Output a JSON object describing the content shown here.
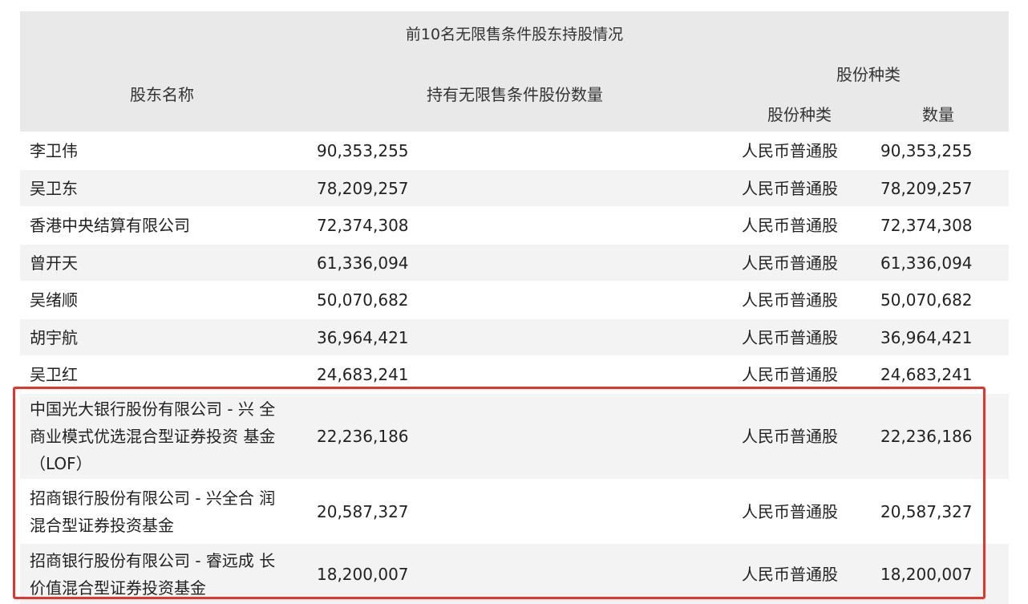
{
  "table": {
    "caption": "前10名无限售条件股东持股情况",
    "headers": {
      "shareholder_name": "股东名称",
      "unrestricted_qty": "持有无限售条件股份数量",
      "share_type_group": "股份种类",
      "share_type": "股份种类",
      "count": "数量"
    },
    "rows": [
      {
        "name_lines": [
          "李卫伟"
        ],
        "qty": "90,353,255",
        "type": "人民币普通股",
        "count": "90,353,255"
      },
      {
        "name_lines": [
          "吴卫东"
        ],
        "qty": "78,209,257",
        "type": "人民币普通股",
        "count": "78,209,257"
      },
      {
        "name_lines": [
          "香港中央结算有限公司"
        ],
        "qty": "72,374,308",
        "type": "人民币普通股",
        "count": "72,374,308"
      },
      {
        "name_lines": [
          "曾开天"
        ],
        "qty": "61,336,094",
        "type": "人民币普通股",
        "count": "61,336,094"
      },
      {
        "name_lines": [
          "吴绪顺"
        ],
        "qty": "50,070,682",
        "type": "人民币普通股",
        "count": "50,070,682"
      },
      {
        "name_lines": [
          "胡宇航"
        ],
        "qty": "36,964,421",
        "type": "人民币普通股",
        "count": "36,964,421"
      },
      {
        "name_lines": [
          "吴卫红"
        ],
        "qty": "24,683,241",
        "type": "人民币普通股",
        "count": "24,683,241"
      },
      {
        "name_lines": [
          "中国光大银行股份有限公司 - 兴 全",
          "商业模式优选混合型证券投资 基金",
          "（LOF）"
        ],
        "qty": "22,236,186",
        "type": "人民币普通股",
        "count": "22,236,186"
      },
      {
        "name_lines": [
          "招商银行股份有限公司 - 兴全合 润",
          "混合型证券投资基金"
        ],
        "qty": "20,587,327",
        "type": "人民币普通股",
        "count": "20,587,327"
      },
      {
        "name_lines": [
          "招商银行股份有限公司 - 睿远成 长",
          "价值混合型证券投资基金"
        ],
        "qty": "18,200,007",
        "type": "人民币普通股",
        "count": "18,200,007"
      }
    ]
  },
  "colors": {
    "header_bg": "#e9e9e9",
    "stripe_bg": "#f3f3f3",
    "highlight_border": "#e8332b"
  }
}
